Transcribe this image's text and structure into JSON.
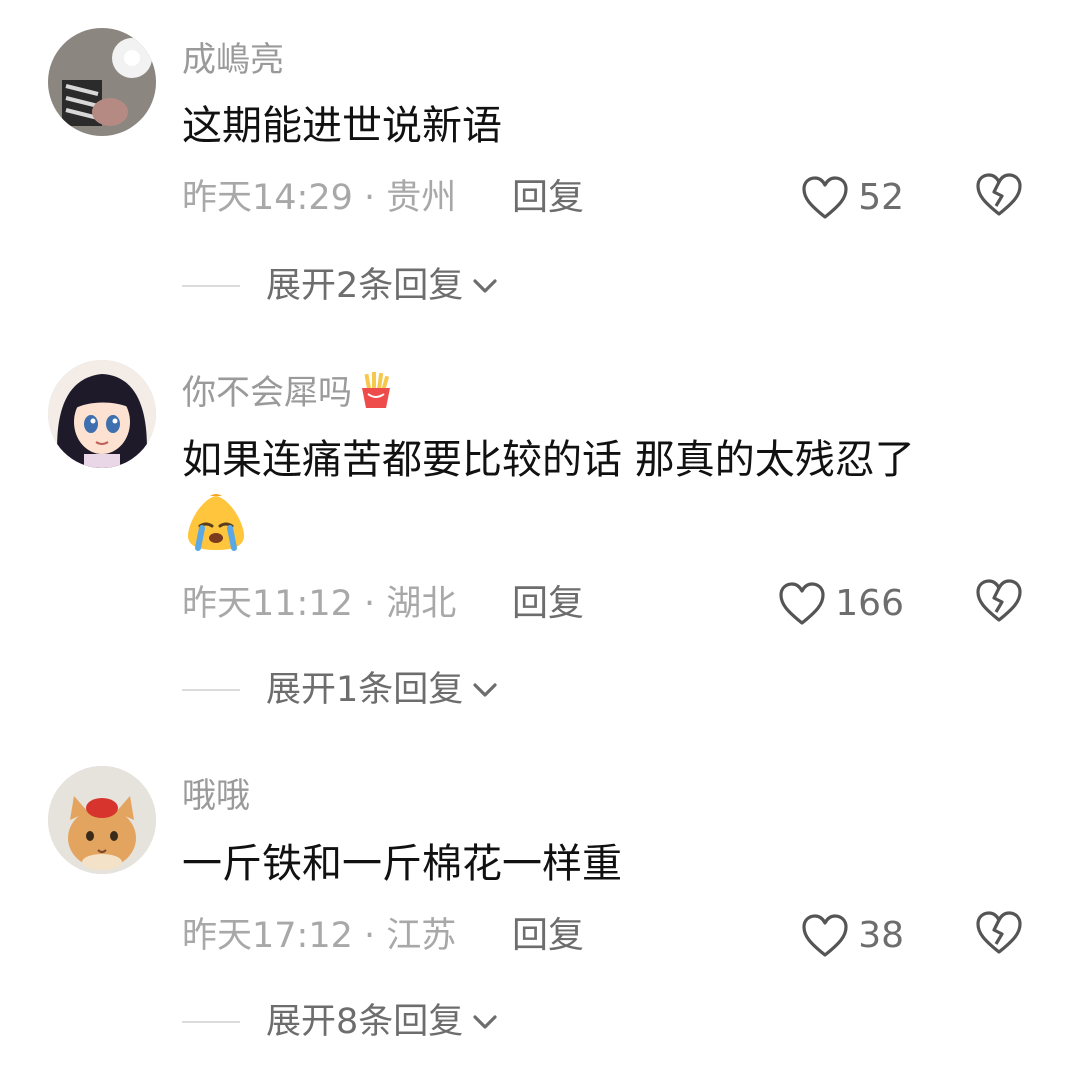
{
  "comments": [
    {
      "username": "成嶋亮",
      "text": "这期能进世说新语",
      "time": "昨天14:29",
      "location": "· 贵州",
      "reply": "回复",
      "likes": "52",
      "expand": "展开2条回复"
    },
    {
      "username": "你不会犀吗",
      "text": "如果连痛苦都要比较的话 那真的太残忍了",
      "time": "昨天11:12",
      "location": "· 湖北",
      "reply": "回复",
      "likes": "166",
      "expand": "展开1条回复"
    },
    {
      "username": "哦哦",
      "text": "一斤铁和一斤棉花一样重",
      "time": "昨天17:12",
      "location": "· 江苏",
      "reply": "回复",
      "likes": "38",
      "expand": "展开8条回复"
    }
  ],
  "icons": {
    "like": "heart-outline-icon",
    "dislike": "broken-heart-icon",
    "expand": "chevron-down-icon",
    "emoji": "crying-face-emoji",
    "badge": "fries-emoji"
  }
}
